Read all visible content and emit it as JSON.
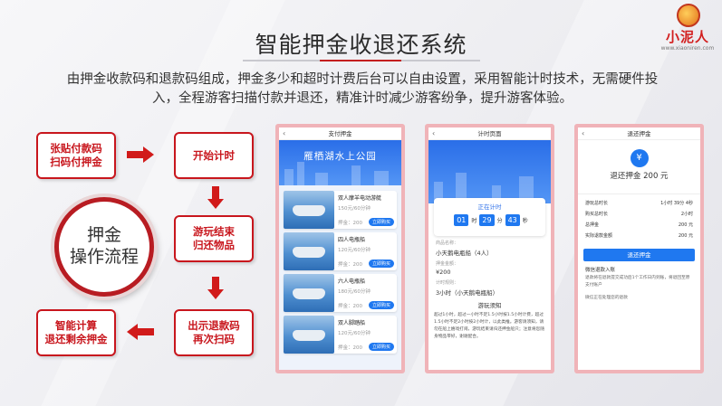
{
  "logo": {
    "brand": "小泥人",
    "url": "www.xiaoniren.com"
  },
  "title": "智能押金收退还系统",
  "intro": "由押金收款码和退款码组成，押金多少和超时计费后台可以自由设置，采用智能计时技术，无需硬件投入，全程游客扫描付款并退还，精准计时减少游客纷争，提升游客体验。",
  "flow": {
    "center": "押金\n操作流程",
    "step1": "张贴付款码\n扫码付押金",
    "step2": "开始计时",
    "step3": "游玩结束\n归还物品",
    "step4": "出示退款码\n再次扫码",
    "step5": "智能计算\n退还剩余押金"
  },
  "phone1": {
    "header": "支付押金",
    "banner": "雁栖湖水上公园",
    "buy_label": "立即购买",
    "boats": [
      {
        "name": "双人摩羊电动游艇",
        "price": "150元/60分钟",
        "deposit": "押金：200"
      },
      {
        "name": "四人电瓶船",
        "price": "120元/60分钟",
        "deposit": "押金：200"
      },
      {
        "name": "六人电瓶船",
        "price": "180元/60分钟",
        "deposit": "押金：200"
      },
      {
        "name": "双人脚踏船",
        "price": "120元/60分钟",
        "deposit": "押金：200"
      }
    ]
  },
  "phone2": {
    "header": "计时页面",
    "timing_label": "正在计时",
    "hours": "01",
    "minutes": "29",
    "seconds": "43",
    "unit_h": "时",
    "unit_m": "分",
    "unit_s": "秒",
    "item_label": "商品名称：",
    "item_value": "小天鹅电瓶船（4人）",
    "deposit_label": "押金金额：",
    "deposit_value": "¥200",
    "rule_label": "计时规则：",
    "rule_value": "3小时（小天鹅电瓶船）",
    "notice_title": "游玩须知",
    "notice_text": "超过1小时，超过一小时不足1.5小时按1.5小时计费，超过1.5小时不足2小时按2小时计，以此类推。游客请须知，请勿在船上嬉戏打闹，游玩结束请归还押金船只；注意将您随身物品带好，谢谢配合。"
  },
  "phone3": {
    "header": "退还押金",
    "icon": "¥",
    "title": "退还押金 200 元",
    "rows": [
      {
        "k": "游玩总时长",
        "v": "1小时 39分 4秒"
      },
      {
        "k": "购买总时长",
        "v": "2小时"
      },
      {
        "k": "总押金",
        "v": "200 元"
      },
      {
        "k": "实际退款金额",
        "v": "200 元"
      }
    ],
    "button": "退还押金",
    "tip_title": "微信退款入账",
    "tip_text": "退款将在退款提交成功后1个工作日内到账，将退回至原支付账户",
    "tip2": "微信正在处理您的退款"
  }
}
